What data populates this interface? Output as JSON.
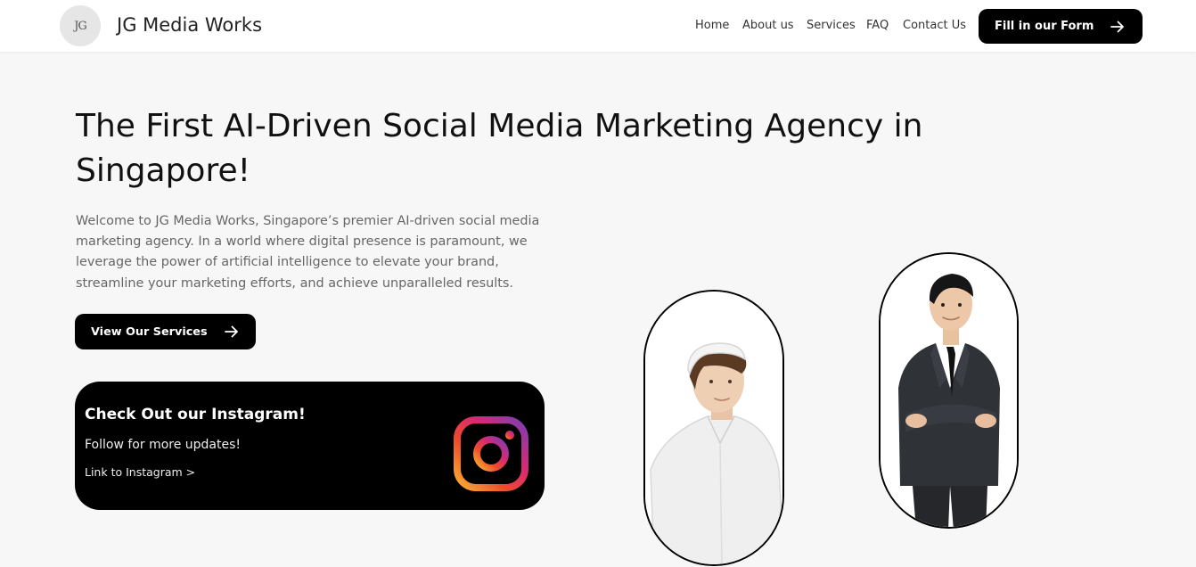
{
  "header": {
    "logo_text": "JG",
    "brand": "JG Media Works",
    "nav": [
      "Home",
      "About us",
      "Services",
      "FAQ",
      "Contact Us"
    ],
    "cta_label": "Fill in our Form"
  },
  "hero": {
    "headline_line1": "The First AI-Driven Social Media Marketing Agency in",
    "headline_line2": "Singapore!",
    "intro": "Welcome to JG Media Works, Singapore’s premier AI-driven social media marketing agency. In a world where digital presence is paramount, we leverage the power of artificial intelligence to elevate your brand, streamline your marketing efforts, and achieve unparalleled results.",
    "services_label": "View Our Services"
  },
  "instagram": {
    "title": "Check Out our Instagram!",
    "subtitle": "Follow for more updates!",
    "link": "Link to Instagram >"
  },
  "icons": {
    "cta_arrow": "arrow-right-icon",
    "instagram": "instagram-icon"
  },
  "colors": {
    "page_bg": "#f7f7f7",
    "button_bg": "#000000",
    "text_muted": "#666666"
  }
}
